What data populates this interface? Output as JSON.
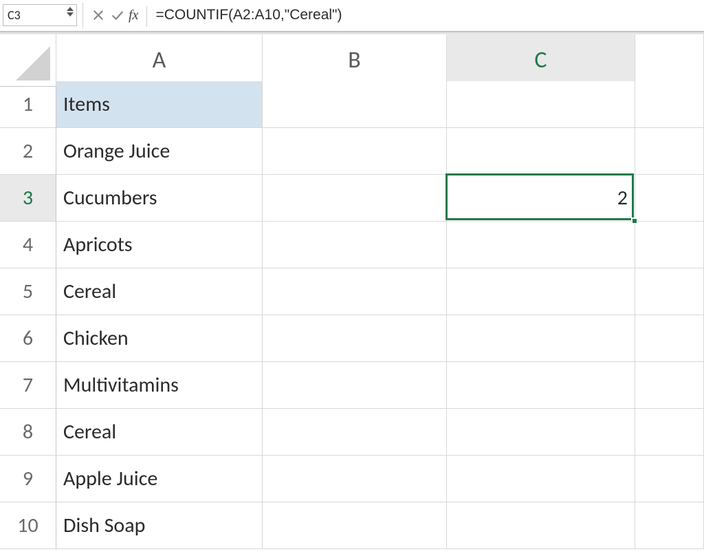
{
  "formula_bar": {
    "cell_reference": "C3",
    "fx_label": "fx",
    "formula": "=COUNTIF(A2:A10,\"Cereal\")"
  },
  "columns": [
    "A",
    "B",
    "C",
    ""
  ],
  "rows": [
    "1",
    "2",
    "3",
    "4",
    "5",
    "6",
    "7",
    "8",
    "9",
    "10"
  ],
  "selected_cell": {
    "ref": "C3",
    "row_index": 2,
    "col_index": 2
  },
  "cells": {
    "A1": "Items",
    "A2": "Orange Juice",
    "A3": "Cucumbers",
    "A4": "Apricots",
    "A5": "Cereal",
    "A6": "Chicken",
    "A7": "Multivitamins",
    "A8": "Cereal",
    "A9": "Apple Juice",
    "A10": "Dish Soap",
    "C3": "2"
  },
  "colors": {
    "selection_green": "#1f7a4a",
    "header_fill": "#d3e2ef"
  }
}
